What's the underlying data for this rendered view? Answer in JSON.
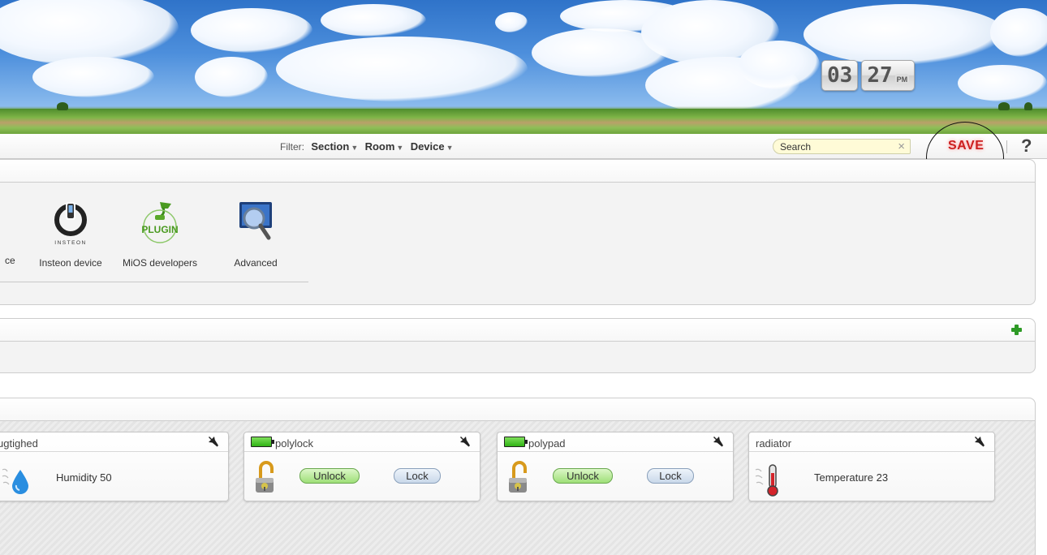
{
  "clock": {
    "hours": "03",
    "minutes": "27",
    "ampm": "PM"
  },
  "toolbar": {
    "filter_label": "Filter:",
    "filters": [
      "Section",
      "Room",
      "Device"
    ],
    "search_placeholder": "Search",
    "search_clear": "×",
    "save_label": "SAVE",
    "help_label": "?"
  },
  "categories": {
    "cut_label": "ce",
    "items": [
      {
        "label": "Insteon device",
        "icon": "insteon-icon",
        "icon_text": "INSTEON"
      },
      {
        "label": "MiOS developers",
        "icon": "plugin-icon",
        "icon_text": "PLUGIN"
      },
      {
        "label": "Advanced",
        "icon": "advanced-magnifier-icon"
      }
    ]
  },
  "devices": [
    {
      "name": "ugtighed",
      "value_label": "Humidity 50",
      "icon": "humidity-icon"
    },
    {
      "name": "polylock",
      "buttons": [
        "Unlock",
        "Lock"
      ],
      "battery": true,
      "icon": "lock-icon"
    },
    {
      "name": "polypad",
      "buttons": [
        "Unlock",
        "Lock"
      ],
      "battery": true,
      "icon": "lock-icon"
    },
    {
      "name": "radiator",
      "value_label": "Temperature 23",
      "icon": "temperature-icon"
    }
  ],
  "colors": {
    "save": "#cc1f1f",
    "add": "#2e9a26",
    "battery": "#2fb214"
  }
}
